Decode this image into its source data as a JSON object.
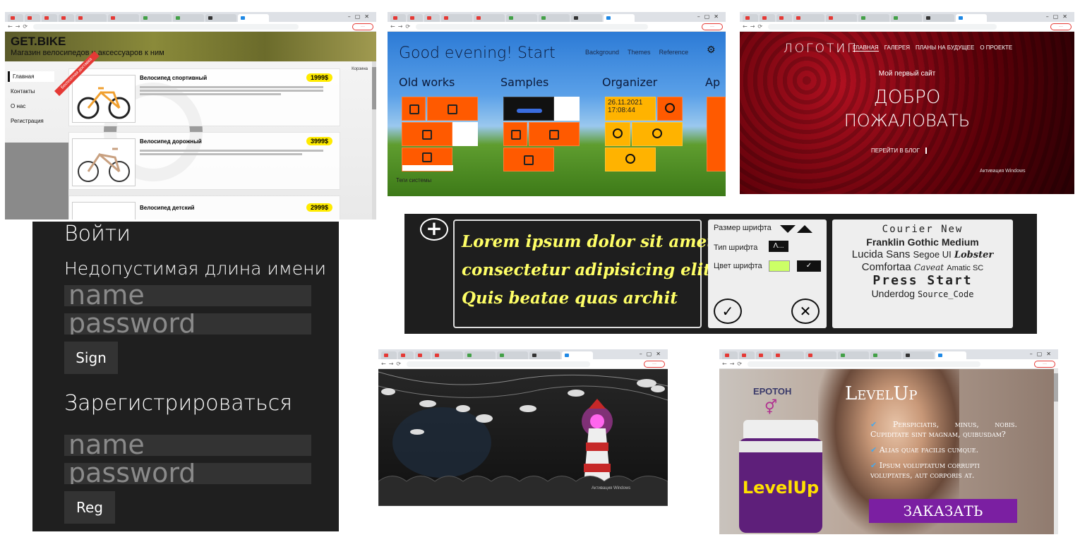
{
  "bike_shop": {
    "logo": "GET.BIKE",
    "tagline": "Магазин велосипедов и аксессуаров к ним",
    "sidebar": [
      "Главная",
      "Контакты",
      "О нас",
      "Регистрация"
    ],
    "ribbon": "Бесплатная доставка",
    "products": [
      {
        "name": "Велосипед спортивный",
        "price": "1999$"
      },
      {
        "name": "Велосипед дорожный",
        "price": "3999$"
      },
      {
        "name": "Велосипед детский",
        "price": "2999$"
      }
    ],
    "right_label": "Корзина"
  },
  "metro_start": {
    "greeting": "Good evening! Start",
    "menu": [
      "Background",
      "Themes",
      "Reference"
    ],
    "groups": [
      "Old works",
      "Samples",
      "Organizer",
      "Ap"
    ],
    "datetime": "26.11.2021 17:08:44",
    "footer_left": "Теги системы",
    "colors": {
      "orange": "#ff5a00",
      "yellow": "#ffb300"
    }
  },
  "roses_site": {
    "logo": "ЛОГОТИП",
    "nav": [
      "ГЛАВНАЯ",
      "ГАЛЕРЕЯ",
      "ПЛАНЫ НА БУДУЩЕЕ",
      "О ПРОЕКТЕ"
    ],
    "subtitle": "Мой первый сайт",
    "headline_1": "ДОБРО",
    "headline_2": "ПОЖАЛОВАТЬ",
    "button": "ПЕРЕЙТИ В БЛОГ",
    "activation": "Активация Windows"
  },
  "login_form": {
    "title": "Войти",
    "error": "Недопустимая длина имени",
    "name_placeholder": "name",
    "password_placeholder": "password",
    "sign_button": "Sign",
    "register_title": "Зарегистрироваться",
    "reg_name_placeholder": "name",
    "reg_password_placeholder": "password",
    "reg_button": "Reg"
  },
  "text_editor": {
    "plus": "+",
    "text_lines": [
      "Lorem ipsum dolor sit amet",
      "consectetur adipisicing elit.",
      "Quis beatae quas archit"
    ],
    "font_size_label": "Размер шрифта",
    "font_type_label": "Тип шрифта",
    "font_type_value": "Λ...",
    "font_color_label": "Цвет шрифта",
    "fonts": [
      "Courier New",
      "Franklin Gothic Medium",
      "Lucida Sans",
      "Segoe UI",
      "Lobster",
      "Comfortaa",
      "Caveat",
      "Amatic SC",
      "Press Start",
      "Underdog",
      "Source_Code"
    ],
    "colors": {
      "text": "#ffff66",
      "swatch": "#ccff66"
    }
  },
  "lighthouse_scene": {
    "caption": "Активация Windows"
  },
  "levelup": {
    "brand": "ЕРОТОН",
    "title": "LevelUp",
    "jar_label": "LevelUp",
    "bullets": [
      "Perspiciatis, minus, nobis. Cupiditate sint magnam, quibusdam?",
      "Alias quae facilis cumque.",
      "Ipsum voluptatum corrupti voluptates, aut corporis at."
    ],
    "order_button": "ЗАКАЗАТЬ",
    "colors": {
      "button": "#7b1fa2",
      "jar": "#5e1f7a",
      "jar_label": "#ffe000"
    }
  }
}
